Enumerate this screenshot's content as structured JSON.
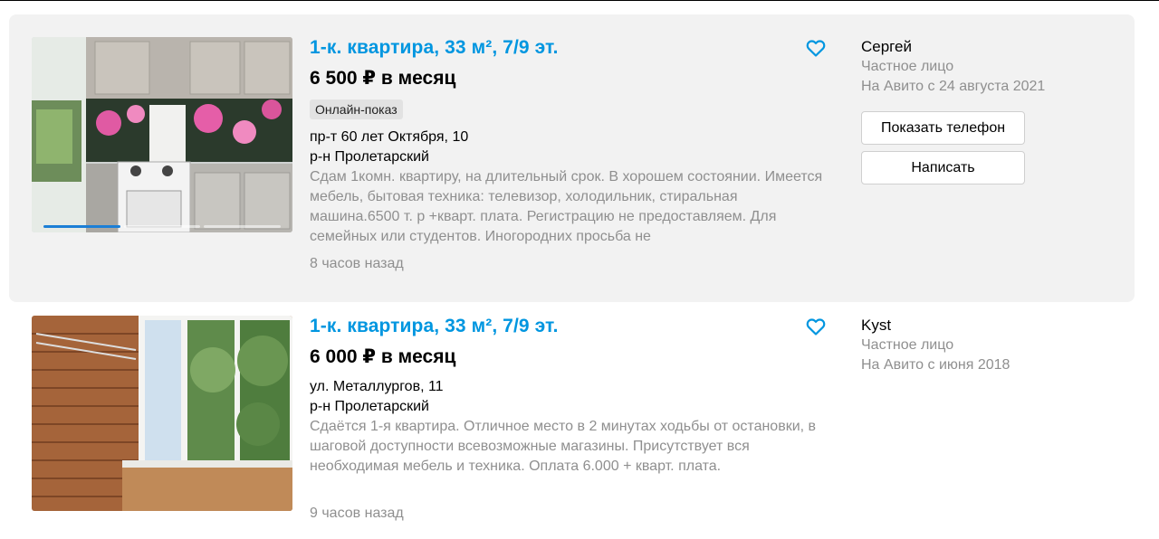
{
  "listings": [
    {
      "title": "1-к. квартира, 33 м², 7/9 эт.",
      "price": "6 500 ₽ в месяц",
      "badge": "Онлайн-показ",
      "address": "пр-т 60 лет Октября, 10",
      "district": "р-н Пролетарский",
      "description": "Сдам 1комн. квартиру, на длительный срок. В хорошем состоянии. Имеется мебель, бытовая техника: телевизор, холодильник, стиральная машина.6500 т. р +кварт. плата. Регистрацию не предоставляем. Для семейных или студентов. Иногородних просьба не",
      "time": "8 часов назад",
      "photo_icon": "kitchen-photo",
      "seller": {
        "name": "Сергей",
        "type": "Частное лицо",
        "since": "На Авито с 24 августа 2021"
      },
      "buttons": {
        "phone": "Показать телефон",
        "write": "Написать"
      }
    },
    {
      "title": "1-к. квартира, 33 м², 7/9 эт.",
      "price": "6 000 ₽ в месяц",
      "address": "ул. Металлургов, 11",
      "district": "р-н Пролетарский",
      "description": "Сдаётся 1-я квартира. Отличное место в 2 минутах ходьбы от остановки, в шаговой доступности всевозможные магазины. Присутствует вся необходимая мебель и техника. Оплата 6.000 + кварт. плата.",
      "time": "9 часов назад",
      "photo_icon": "balcony-photo",
      "seller": {
        "name": "Kyst",
        "type": "Частное лицо",
        "since": "На Авито с июня 2018"
      }
    }
  ],
  "colors": {
    "title": "#0096e0",
    "muted": "#8f8f8f",
    "hover_bg": "#f2f2f2",
    "heart": "#0096e0"
  }
}
